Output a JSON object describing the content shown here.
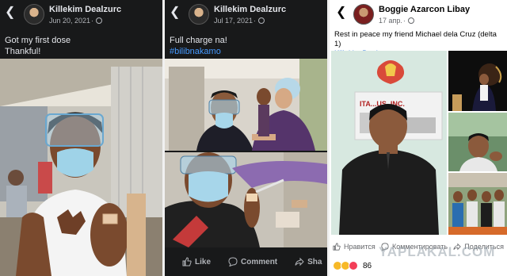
{
  "post1": {
    "author": "Killekim Dealzurc",
    "date": "Jun 20, 2021",
    "text_line1": "Got my first dose",
    "text_line2": "Thankful!"
  },
  "post2": {
    "author": "Killekim Dealzurc",
    "date": "Jul 17, 2021",
    "text_line1": "Full charge na!",
    "hashtag": "#bilibnakamo",
    "actions": {
      "like": "Like",
      "comment": "Comment",
      "share": "Sha"
    }
  },
  "post3": {
    "author": "Boggie Azarcon Libay",
    "date": "17 апр.",
    "text_line1": "Rest in peace my friend Michael dela Cruz (delta 1)",
    "mention": "Killekim Dealzurc",
    "sign_text": "ITA...US, INC.",
    "actions": {
      "like": "Нравится",
      "comment": "Комментировать",
      "share": "Поделиться"
    },
    "reaction_count": "86"
  },
  "watermark": "YAPLAKAL.COM",
  "colors": {
    "dark_bg": "#18191a",
    "link_blue": "#4599ff",
    "fb_blue": "#216fdb"
  }
}
